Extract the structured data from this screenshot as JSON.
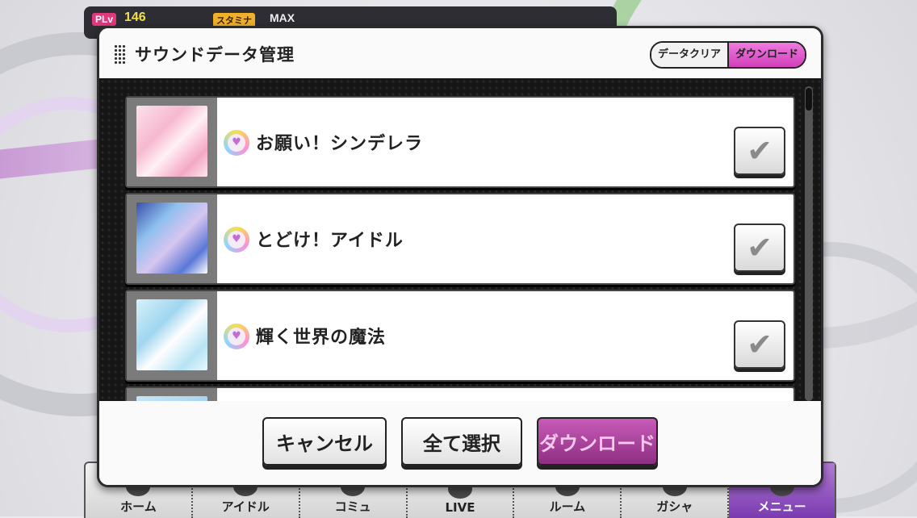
{
  "status": {
    "plv_label": "PLv",
    "plv_value": "146",
    "stamina_label": "スタミナ",
    "stamina_value": "MAX"
  },
  "modal": {
    "title": "サウンドデータ管理",
    "segment": {
      "clear_label": "データクリア",
      "download_label": "ダウンロード",
      "active": "download"
    },
    "songs": [
      {
        "title": "お願い！シンデレラ",
        "checked": true
      },
      {
        "title": "とどけ！アイドル",
        "checked": true
      },
      {
        "title": "輝く世界の魔法",
        "checked": true
      }
    ],
    "buttons": {
      "cancel": "キャンセル",
      "select_all": "全て選択",
      "download": "ダウンロード"
    }
  },
  "nav": {
    "items": [
      {
        "label": "ホーム"
      },
      {
        "label": "アイドル"
      },
      {
        "label": "コミュ"
      },
      {
        "label": "LIVE"
      },
      {
        "label": "ルーム"
      },
      {
        "label": "ガシャ"
      },
      {
        "label": "メニュー"
      }
    ]
  },
  "icons": {
    "check": "checkmark-icon",
    "song_type": "heart-type-icon"
  },
  "colors": {
    "accent": "#d23fba",
    "download_button": "#8e2f82",
    "modal_border": "#2c2c2c"
  }
}
